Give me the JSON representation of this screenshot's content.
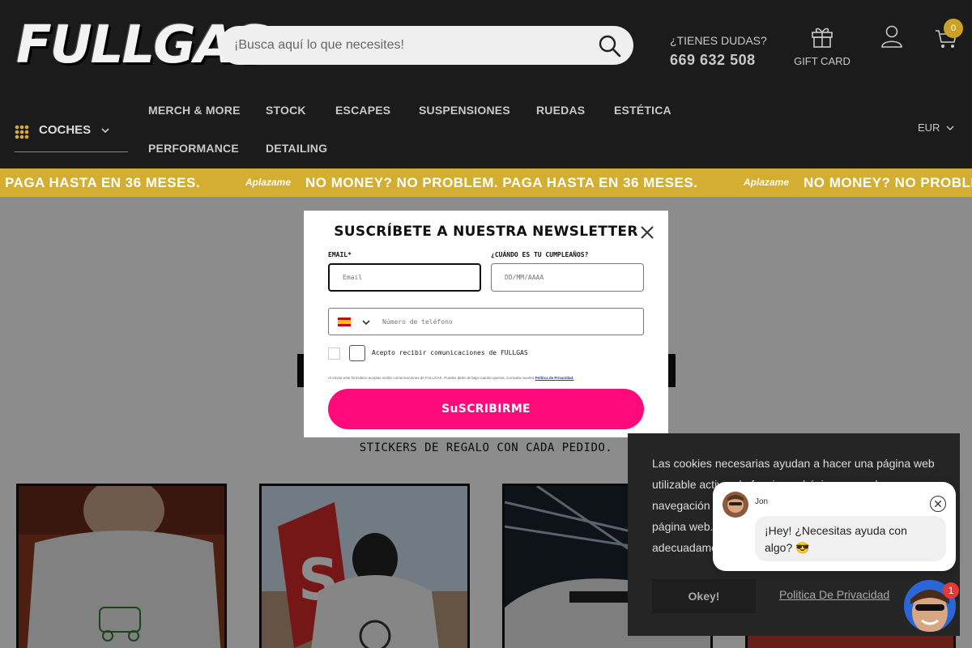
{
  "header": {
    "logo_text": "FULLGAS",
    "search_placeholder": "¡Busca aquí lo que necesites!",
    "help_question": "¿TIENES DUDAS?",
    "help_phone": "669 632 508",
    "gift_card_label": "GIFT CARD",
    "cart_count": "0"
  },
  "nav": {
    "category_label": "COCHES",
    "items": [
      "MERCH & MORE",
      "STOCK",
      "ESCAPES",
      "SUSPENSIONES",
      "RUEDAS",
      "ESTÉTICA",
      "PERFORMANCE",
      "DETAILING"
    ],
    "currency": "EUR"
  },
  "ticker": {
    "fragment": "PAGA HASTA EN 36 MESES.",
    "message": "NO MONEY? NO PROBLEM. PAGA HASTA EN 36 MESES.",
    "message_cut": "NO MONEY? NO PROBLE",
    "brand": "Aplazame",
    "color": "#d4ae31"
  },
  "page": {
    "stickers_note": "STICKERS DE REGALO CON CADA PEDIDO."
  },
  "newsletter": {
    "title": "SUSCRÍBETE A NUESTRA NEWSLETTER",
    "email_label": "EMAIL*",
    "email_placeholder": "Email",
    "birthday_label": "¿CUÁNDO ES TU CUMPLEAÑOS?",
    "birthday_placeholder": "DD/MM/AAAA",
    "phone_placeholder": "Número de teléfono",
    "consent_label": "Acepto recibir comunicaciones de FULLGAS",
    "legal_text": "Al enviar este formulario aceptas recibir comunicaciones de FULLGAS. Puedes darte de baja cuando quieras. Consulta nuestra",
    "legal_link": "Política de Privacidad.",
    "submit_label": "SuSCRIBIRME",
    "accent_color": "#ff0a7a"
  },
  "cookies": {
    "text": "Las cookies necesarias ayudan a hacer una página web utilizable activando funciones básicas como la navegación de página y el acceso a áreas seguras de la página web. La página web no puede funcionar adecuadamente sin estas cookies.",
    "accept_label": "Okey!",
    "privacy_label": "Politica De Privacidad"
  },
  "chat": {
    "agent_name": "Jon",
    "message": "¡Hey! ¿Necesitas ayuda con algo? 😎",
    "badge_count": "1"
  }
}
